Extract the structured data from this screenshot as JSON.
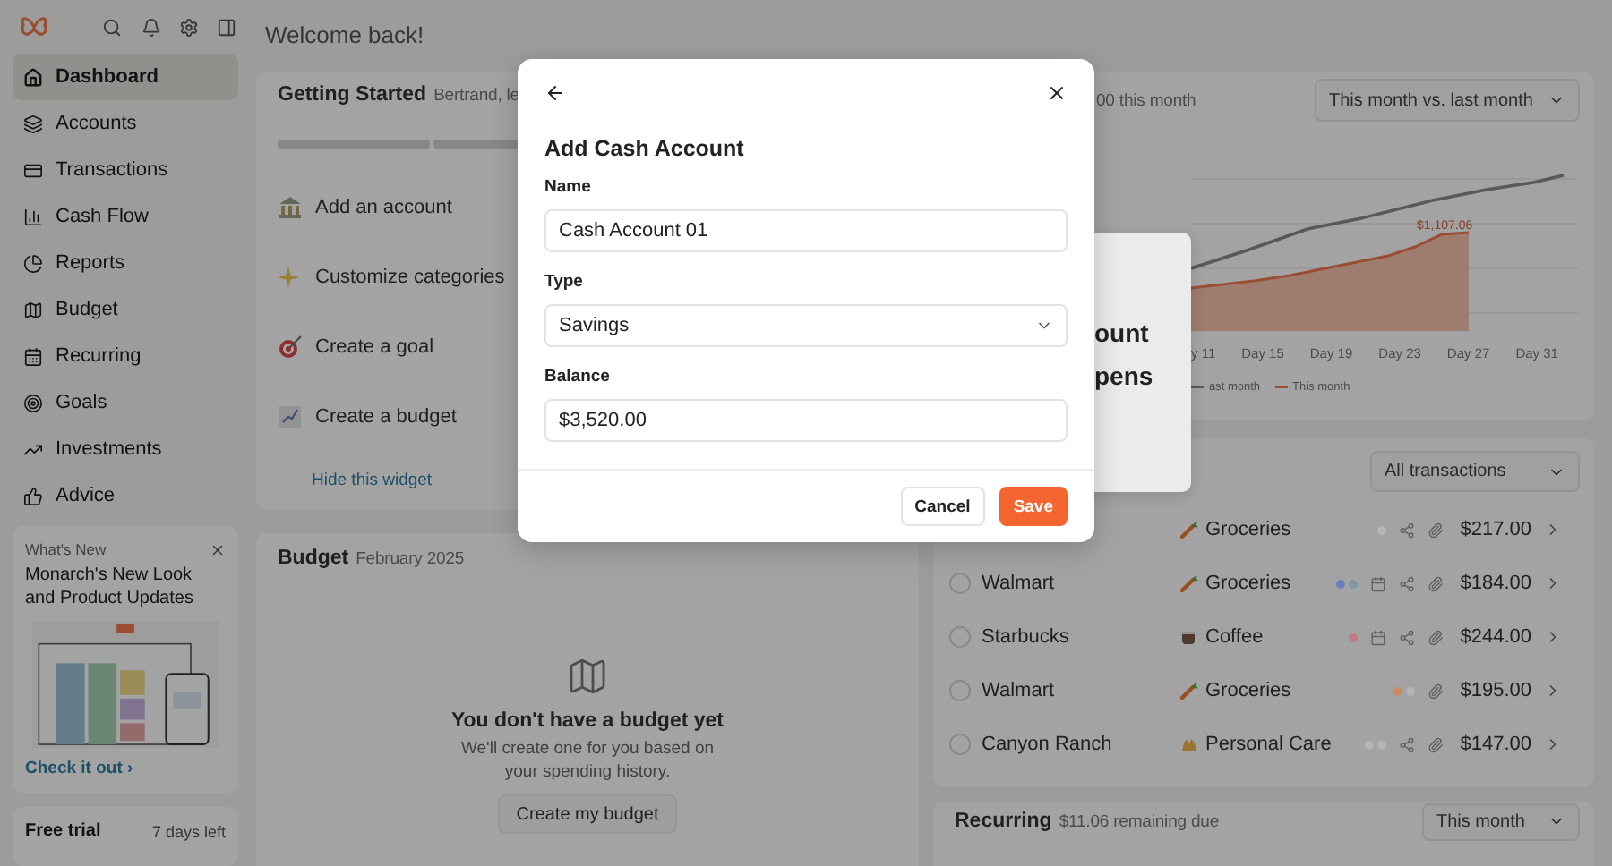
{
  "topbar": {
    "title": "Welcome back!"
  },
  "sidebar": {
    "nav": [
      {
        "label": "Dashboard",
        "selected": true
      },
      {
        "label": "Accounts",
        "selected": false
      },
      {
        "label": "Transactions",
        "selected": false
      },
      {
        "label": "Cash Flow",
        "selected": false
      },
      {
        "label": "Reports",
        "selected": false
      },
      {
        "label": "Budget",
        "selected": false
      },
      {
        "label": "Recurring",
        "selected": false
      },
      {
        "label": "Goals",
        "selected": false
      },
      {
        "label": "Investments",
        "selected": false
      },
      {
        "label": "Advice",
        "selected": false
      }
    ],
    "whats_new": {
      "label": "What's New",
      "title": "Monarch's New Look and Product Updates",
      "link": "Check it out ›"
    },
    "trial": {
      "label": "Free trial",
      "remaining": "7 days left"
    }
  },
  "getting_started": {
    "title": "Getting Started",
    "subtitle": "Bertrand, le",
    "items": [
      {
        "label": "Add an account",
        "kind": "bank"
      },
      {
        "label": "Customize categories",
        "kind": "sparkle"
      },
      {
        "label": "Create a goal",
        "kind": "target"
      },
      {
        "label": "Create a budget",
        "kind": "chart"
      }
    ],
    "link": "Hide this widget"
  },
  "budget": {
    "title": "Budget",
    "period": "February 2025",
    "heading": "You don't have a budget yet",
    "text": "We'll create one for you based on your spending history.",
    "button": "Create my budget"
  },
  "spending": {
    "subtitle": "00 this month",
    "range": "This month vs. last month",
    "value_label": "$1,107.06",
    "x_labels": [
      "y 11",
      "Day 15",
      "Day 19",
      "Day 23",
      "Day 27",
      "Day 31"
    ],
    "legend": [
      "ast month",
      "This month"
    ]
  },
  "popover": {
    "lines": [
      "ount",
      "pens"
    ]
  },
  "transactions": {
    "filter": "All transactions",
    "rows": [
      {
        "category": "Groceries",
        "kind": "groceries",
        "dots": [
          {
            "color": "#b5b5b5"
          }
        ],
        "calendar": false,
        "share": true,
        "amount": "$217.00"
      },
      {
        "checked": false,
        "merchant": "Walmart",
        "category": "Groceries",
        "kind": "groceries",
        "dots": [
          {
            "color": "#6f7cc4"
          },
          {
            "color": "#7d9aa0"
          }
        ],
        "calendar": true,
        "share": true,
        "amount": "$184.00"
      },
      {
        "checked": false,
        "merchant": "Starbucks",
        "category": "Coffee",
        "kind": "coffee",
        "dots": [
          {
            "color": "#c27a82"
          }
        ],
        "calendar": true,
        "share": true,
        "amount": "$244.00"
      },
      {
        "checked": false,
        "merchant": "Walmart",
        "category": "Groceries",
        "kind": "groceries",
        "dots": [
          {
            "color": "#c98a66"
          },
          {
            "color": "#b5b5b5"
          }
        ],
        "calendar": false,
        "share": false,
        "amount": "$195.00"
      },
      {
        "checked": false,
        "merchant": "Canyon Ranch",
        "category": "Personal Care",
        "kind": "care",
        "dots": [
          {
            "color": "#b5b5b5"
          },
          {
            "color": "#b5b5b5"
          }
        ],
        "calendar": false,
        "share": true,
        "amount": "$147.00"
      }
    ]
  },
  "recurring": {
    "title": "Recurring",
    "subtitle": "$11.06 remaining due",
    "range": "This month"
  },
  "modal": {
    "title": "Add Cash Account",
    "fields": [
      {
        "label": "Name",
        "kind": "text",
        "value": "Cash Account 01"
      },
      {
        "label": "Type",
        "kind": "select",
        "value": "Savings"
      },
      {
        "label": "Balance",
        "kind": "text",
        "value": "$3,520.00"
      }
    ],
    "buttons": [
      {
        "label": "Cancel",
        "kind": "secondary"
      },
      {
        "label": "Save",
        "kind": "primary"
      }
    ]
  }
}
